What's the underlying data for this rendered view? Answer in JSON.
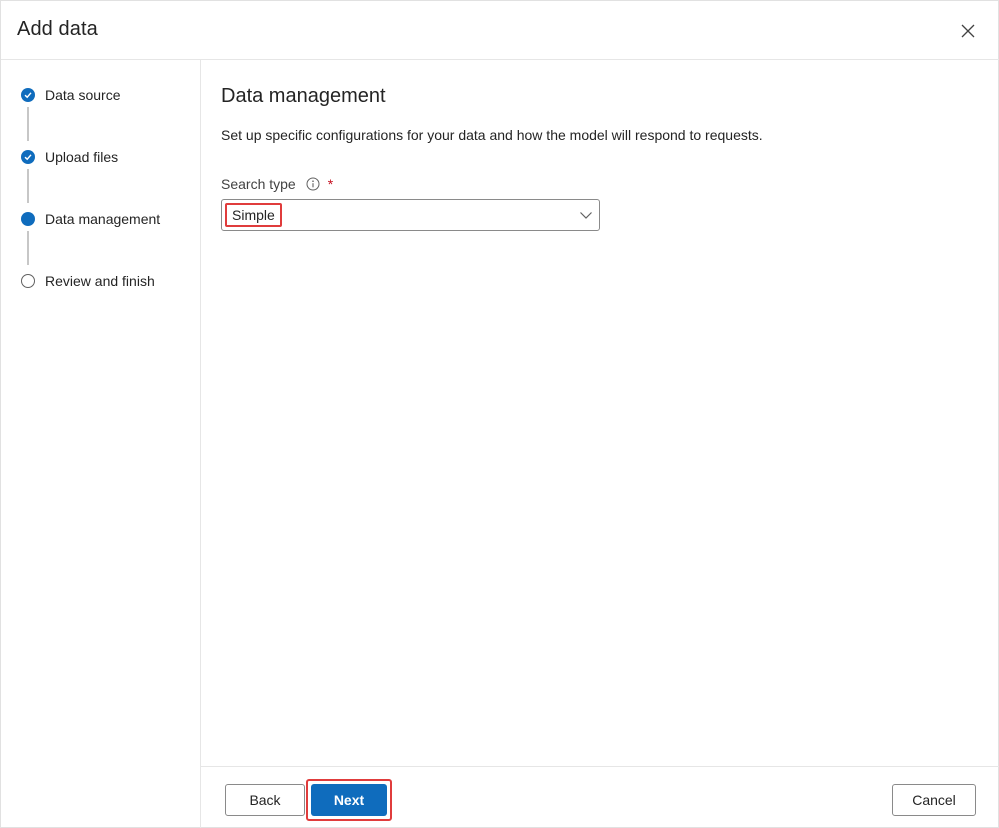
{
  "dialog": {
    "title": "Add data",
    "close_icon": "close-icon"
  },
  "steps": [
    {
      "label": "Data source",
      "state": "done",
      "icon": "check-icon"
    },
    {
      "label": "Upload files",
      "state": "done",
      "icon": "check-icon"
    },
    {
      "label": "Data management",
      "state": "current",
      "icon": "dot-icon"
    },
    {
      "label": "Review and finish",
      "state": "todo",
      "icon": "circle-icon"
    }
  ],
  "main": {
    "heading": "Data management",
    "description": "Set up specific configurations for your data and how the model will respond to requests.",
    "search_type": {
      "label": "Search type",
      "required_marker": "*",
      "info_icon": "info-icon",
      "selected_value": "Simple"
    }
  },
  "footer": {
    "back_label": "Back",
    "next_label": "Next",
    "cancel_label": "Cancel"
  },
  "colors": {
    "accent": "#0f6cbd",
    "highlight": "#e03c3c",
    "required": "#c50f1f"
  }
}
